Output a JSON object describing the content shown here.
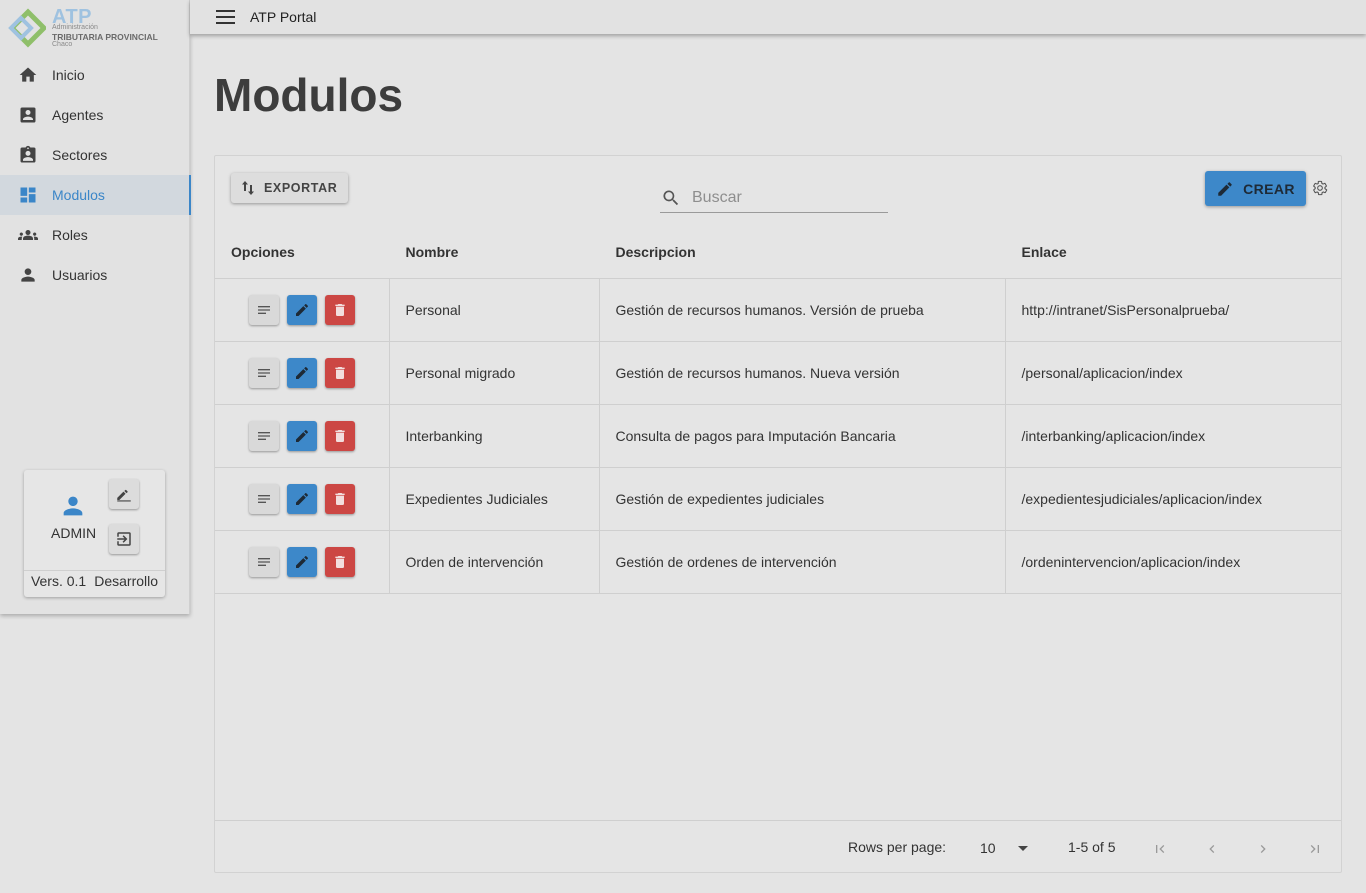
{
  "logo": {
    "brand": "ATP",
    "line1": "Administración",
    "line2": "TRIBUTARIA PROVINCIAL",
    "line3": "Chaco"
  },
  "sidebar": {
    "items": [
      {
        "label": "Inicio",
        "icon": "home-icon"
      },
      {
        "label": "Agentes",
        "icon": "account-box-icon"
      },
      {
        "label": "Sectores",
        "icon": "assignment-ind-icon"
      },
      {
        "label": "Modulos",
        "icon": "dashboard-icon",
        "active": true
      },
      {
        "label": "Roles",
        "icon": "people-icon"
      },
      {
        "label": "Usuarios",
        "icon": "person-icon"
      }
    ],
    "user": {
      "name": "ADMIN",
      "version": "Vers. 0.1",
      "environment": "Desarrollo"
    }
  },
  "topbar": {
    "title": "ATP Portal"
  },
  "page": {
    "title": "Modulos"
  },
  "toolbar": {
    "export_label": "EXPORTAR",
    "search_placeholder": "Buscar",
    "create_label": "CREAR"
  },
  "table": {
    "columns": [
      "Opciones",
      "Nombre",
      "Descripcion",
      "Enlace"
    ],
    "rows": [
      {
        "nombre": "Personal",
        "descripcion": "Gestión de recursos humanos. Versión de prueba",
        "enlace": "http://intranet/SisPersonalprueba/"
      },
      {
        "nombre": "Personal migrado",
        "descripcion": "Gestión de recursos humanos. Nueva versión",
        "enlace": "/personal/aplicacion/index"
      },
      {
        "nombre": "Interbanking",
        "descripcion": "Consulta de pagos para Imputación Bancaria",
        "enlace": "/interbanking/aplicacion/index"
      },
      {
        "nombre": "Expedientes Judiciales",
        "descripcion": "Gestión de expedientes judiciales",
        "enlace": "/expedientesjudiciales/aplicacion/index"
      },
      {
        "nombre": "Orden de intervención",
        "descripcion": "Gestión de ordenes de intervención",
        "enlace": "/ordenintervencion/aplicacion/index"
      }
    ]
  },
  "pagination": {
    "rows_per_page_label": "Rows per page:",
    "rows_per_page": "10",
    "range": "1-5 of 5"
  },
  "colors": {
    "accent": "#3d88c9",
    "danger": "#cc4744",
    "background": "#e4e4e4"
  }
}
